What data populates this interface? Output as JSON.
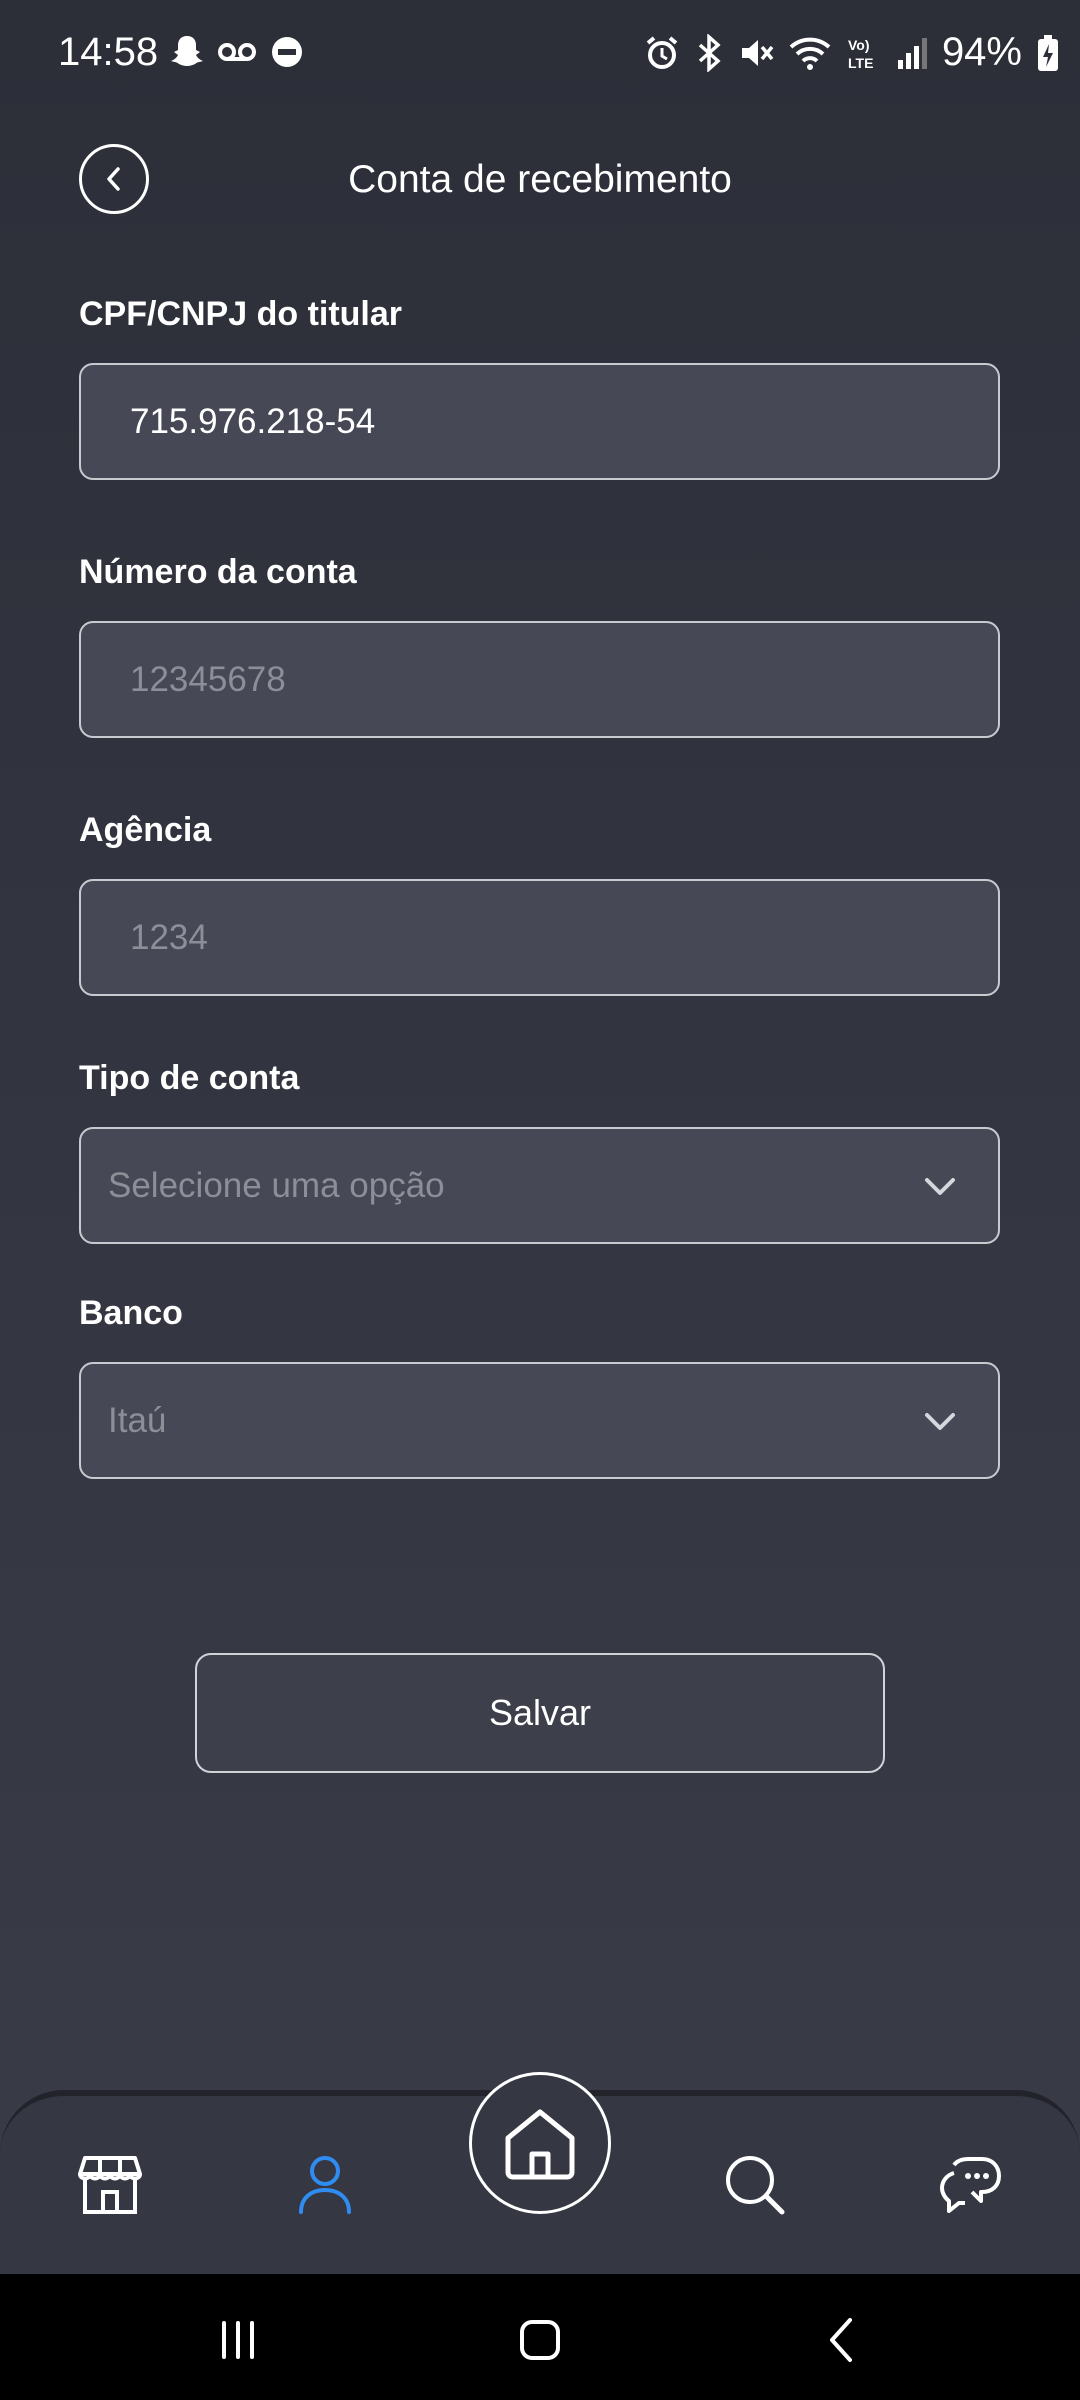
{
  "status_bar": {
    "time": "14:58",
    "battery": "94%",
    "icons_left": [
      "snapchat-icon",
      "voicemail-icon",
      "do-not-disturb-icon"
    ],
    "icons_right": [
      "alarm-icon",
      "bluetooth-icon",
      "mute-icon",
      "wifi-icon",
      "volte-icon",
      "signal-icon",
      "battery-charging-icon"
    ]
  },
  "header": {
    "title": "Conta de recebimento",
    "back_icon": "chevron-left-icon"
  },
  "form": {
    "document": {
      "label": "CPF/CNPJ do titular",
      "value": "715.976.218-54"
    },
    "account_number": {
      "label": "Número da conta",
      "placeholder": "12345678"
    },
    "agency": {
      "label": "Agência",
      "placeholder": "1234"
    },
    "account_type": {
      "label": "Tipo de conta",
      "placeholder": "Selecione uma opção"
    },
    "bank": {
      "label": "Banco",
      "placeholder": "Itaú"
    }
  },
  "actions": {
    "save_label": "Salvar"
  },
  "bottom_nav": {
    "items": [
      {
        "icon": "store-icon",
        "active": false
      },
      {
        "icon": "user-icon",
        "active": true
      },
      {
        "icon": "home-icon",
        "active": false
      },
      {
        "icon": "search-icon",
        "active": false
      },
      {
        "icon": "chat-icon",
        "active": false
      }
    ],
    "active_color": "#2f8cf0"
  },
  "system_nav": [
    "recents-icon",
    "home-button-icon",
    "back-icon"
  ]
}
